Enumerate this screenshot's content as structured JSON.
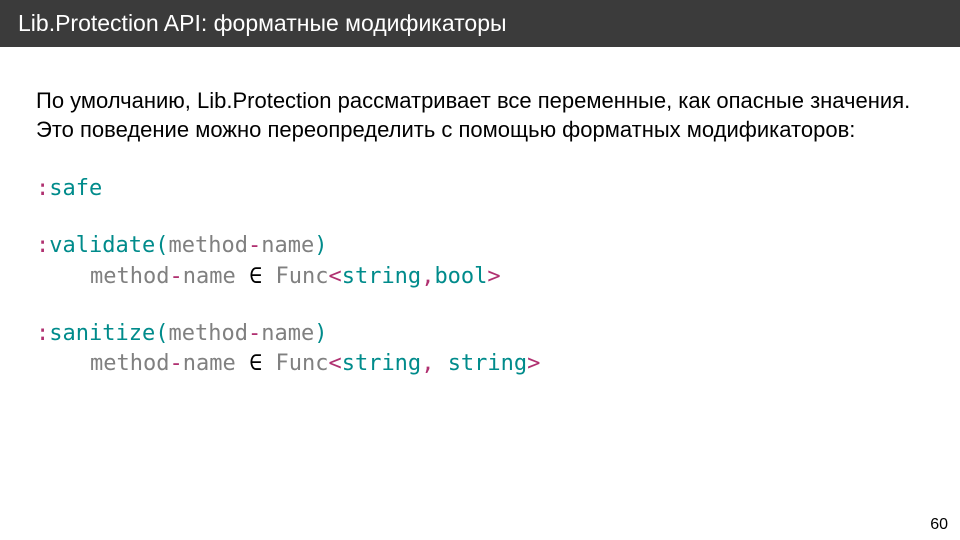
{
  "header": {
    "title": "Lib.Protection API: форматные модификаторы"
  },
  "intro": "По умолчанию, Lib.Protection рассматривает все переменные, как опасные значения. Это поведение можно переопределить с помощью форматных модификаторов:",
  "code": {
    "safe": {
      "colon": ":",
      "name": "safe"
    },
    "validate": {
      "colon": ":",
      "name": "validate",
      "lparen": "(",
      "method": "method",
      "dash": "-",
      "nm": "name",
      "rparen": ")",
      "line2_method": "method",
      "line2_dash": "-",
      "line2_name": "name",
      "elem": " ∈ ",
      "func": "Func",
      "lt": "<",
      "t1": "string",
      "comma": ",",
      "t2": "bool",
      "gt": ">"
    },
    "sanitize": {
      "colon": ":",
      "name": "sanitize",
      "lparen": "(",
      "method": "method",
      "dash": "-",
      "nm": "name",
      "rparen": ")",
      "line2_method": "method",
      "line2_dash": "-",
      "line2_name": "name",
      "elem": " ∈ ",
      "func": "Func",
      "lt": "<",
      "t1": "string",
      "comma": ", ",
      "t2": "string",
      "gt": ">"
    }
  },
  "page": "60"
}
